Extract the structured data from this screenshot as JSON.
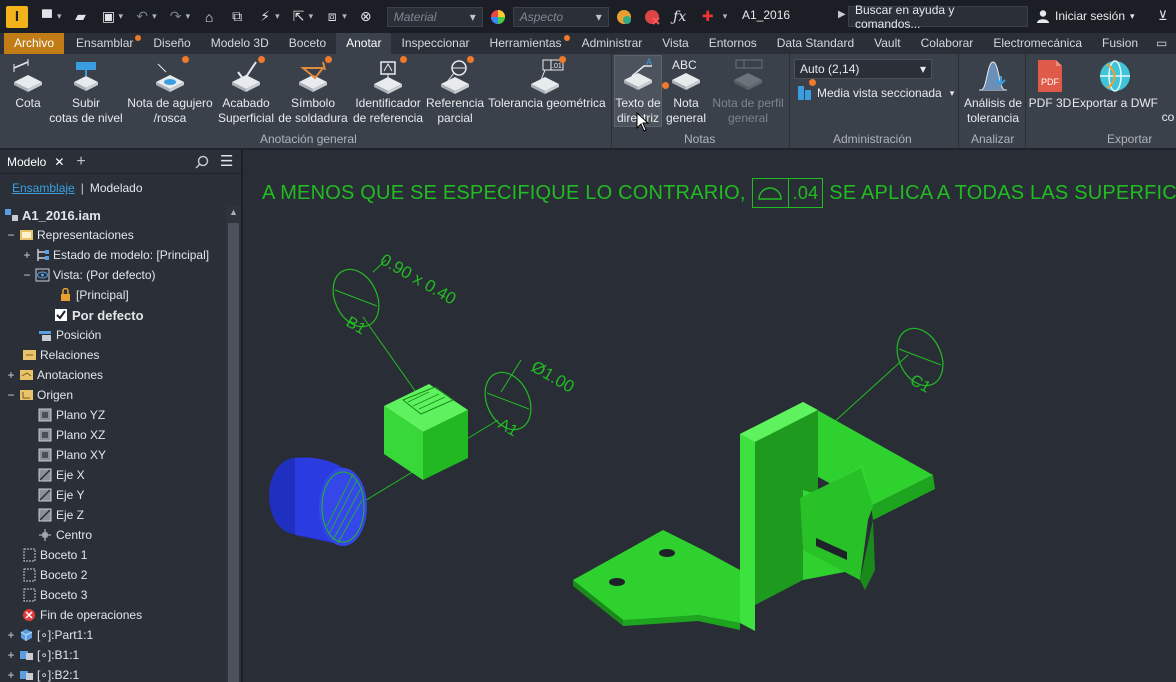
{
  "qat": {
    "material_placeholder": "Material",
    "aspect_placeholder": "Aspecto",
    "doc_title": "A1_2016",
    "help_search": "Buscar en ayuda y comandos...",
    "signin": "Iniciar sesión"
  },
  "tabs": [
    "Archivo",
    "Ensamblar",
    "Diseño",
    "Modelo 3D",
    "Boceto",
    "Anotar",
    "Inspeccionar",
    "Herramientas",
    "Administrar",
    "Vista",
    "Entornos",
    "Data Standard",
    "Vault",
    "Colaborar",
    "Electromecánica",
    "Fusion"
  ],
  "active_tab": "Anotar",
  "ribbon": {
    "buttons": {
      "cota": "Cota",
      "subir1": "Subir",
      "subir2": "cotas de nivel",
      "agujero1": "Nota de agujero",
      "agujero2": "/rosca",
      "acabado1": "Acabado",
      "acabado2": "Superficial",
      "soldadura1": "Símbolo",
      "soldadura2": "de soldadura",
      "ident1": "Identificador",
      "ident2": "de referencia",
      "refp1": "Referencia",
      "refp2": "parcial",
      "tolgeo": "Tolerancia geométrica",
      "texto1": "Texto de",
      "texto2": "directriz",
      "nota1": "Nota",
      "nota2": "general",
      "perfil1": "Nota de perfil",
      "perfil2": "general",
      "analisis1": "Análisis de",
      "analisis2": "tolerancia",
      "pdf3d": "PDF 3D",
      "dwf": "Exportar a DWF",
      "co": "co"
    },
    "icon_text": {
      "abc": "ABC",
      "pdf": "PDF",
      "ten": ".01"
    },
    "auto_select": "Auto (2,14)",
    "media_vista": "Media vista seccionada",
    "panels": {
      "anotacion": "Anotación general",
      "notas": "Notas",
      "administracion": "Administración",
      "analizar": "Analizar",
      "exportar": "Exportar"
    }
  },
  "browser": {
    "tab": "Modelo",
    "switch_a": "Ensamblaje",
    "switch_sep": "|",
    "switch_b": "Modelado",
    "tree": [
      {
        "label": "A1_2016.iam",
        "bold": true
      },
      {
        "label": "Representaciones"
      },
      {
        "label": "Estado de modelo: [Principal]"
      },
      {
        "label": "Vista: (Por defecto)"
      },
      {
        "label": "[Principal]"
      },
      {
        "label": "Por defecto",
        "bold": true
      },
      {
        "label": "Posición"
      },
      {
        "label": "Relaciones"
      },
      {
        "label": "Anotaciones"
      },
      {
        "label": "Origen"
      },
      {
        "label": "Plano YZ"
      },
      {
        "label": "Plano XZ"
      },
      {
        "label": "Plano XY"
      },
      {
        "label": "Eje X"
      },
      {
        "label": "Eje Y"
      },
      {
        "label": "Eje Z"
      },
      {
        "label": "Centro"
      },
      {
        "label": "Boceto 1"
      },
      {
        "label": "Boceto 2"
      },
      {
        "label": "Boceto 3"
      },
      {
        "label": "Fin de operaciones"
      },
      {
        "label": "[∘]:Part1:1"
      },
      {
        "label": "[∘]:B1:1"
      },
      {
        "label": "[∘]:B2:1"
      }
    ]
  },
  "viewport": {
    "note_prefix": "A MENOS QUE SE ESPECIFIQUE LO CONTRARIO,",
    "note_value": ".04",
    "note_suffix": "SE APLICA A TODAS LAS SUPERFICIES",
    "b1_label": "B1",
    "b1_dim": "0.90 x 0.40",
    "a1_label": "A1",
    "a1_dim": "Ø1.00",
    "c1_label": "C1"
  },
  "colors": {
    "annotation": "#22bb22",
    "part_green": "#2fd12f",
    "part_blue": "#2233d8",
    "accent_orange": "#f07a2c",
    "archivo_tab": "#c27c16"
  }
}
